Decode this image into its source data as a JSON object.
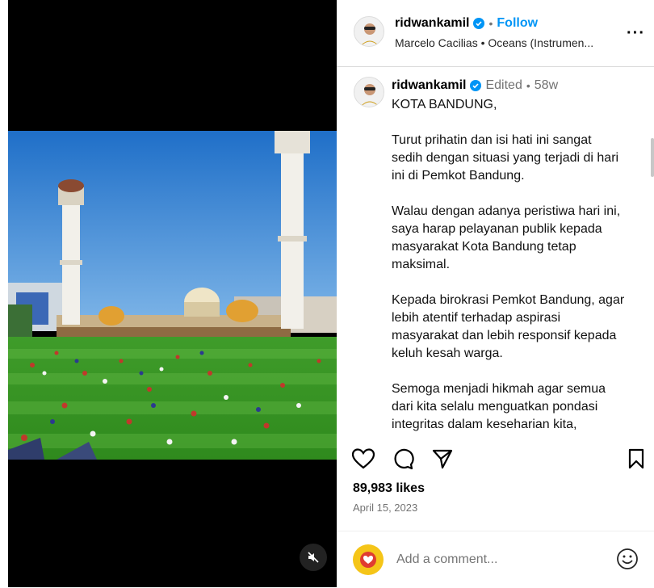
{
  "header": {
    "username": "ridwankamil",
    "separator": "•",
    "follow_label": "Follow",
    "audio": "Marcelo Cacilias • Oceans (Instrumen...",
    "more_label": "···"
  },
  "caption": {
    "username": "ridwankamil",
    "edited": "Edited",
    "separator": "•",
    "age": "58w",
    "lines": [
      "KOTA BANDUNG,",
      "Turut prihatin dan isi hati ini sangat sedih dengan situasi yang terjadi di hari ini di Pemkot Bandung.",
      "Walau dengan adanya peristiwa hari ini, saya harap pelayanan publik kepada masyarakat Kota Bandung tetap maksimal.",
      "Kepada birokrasi Pemkot Bandung, agar lebih atentif terhadap aspirasi masyarakat dan lebih responsif kepada keluh kesah warga.",
      "Semoga menjadi hikmah agar semua dari kita selalu menguatkan pondasi integritas dalam keseharian kita,"
    ]
  },
  "stats": {
    "likes": "89,983 likes",
    "date": "April 15, 2023"
  },
  "comment": {
    "placeholder": "Add a comment..."
  },
  "icons": {
    "verified": "verified-badge-icon",
    "like": "heart-icon",
    "comment": "comment-icon",
    "share": "share-icon",
    "save": "bookmark-icon",
    "mute": "speaker-muted-icon",
    "emoji": "emoji-icon"
  },
  "colors": {
    "accent": "#0095f6",
    "muted": "#737373",
    "comment_avatar": "#f5c518"
  }
}
